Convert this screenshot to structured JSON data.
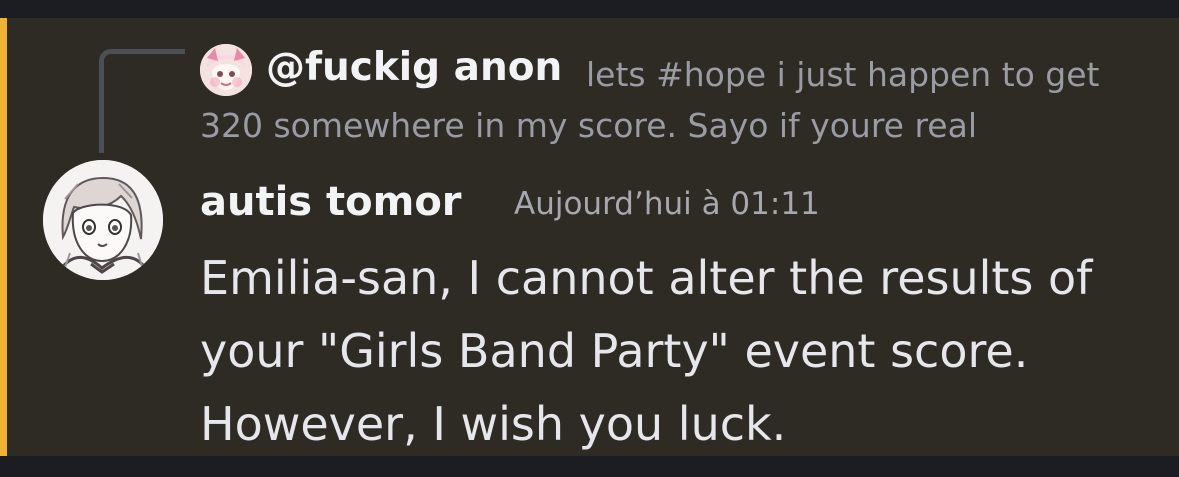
{
  "reply": {
    "author": "@fuckig anon",
    "preview": "lets #hope i just happen to get 320 somewhere in my score. Sayo if youre real",
    "avatar_icon": "anime-girl-avatar-icon"
  },
  "message": {
    "author": "autis tomor",
    "timestamp": "Aujourd’hui à 01:11",
    "avatar_icon": "sketched-anime-avatar-icon",
    "lines": [
      "Emilia-san, I cannot alter the results of",
      "your \"Girls Band Party\" event score.",
      "However, I wish you luck."
    ]
  },
  "colors": {
    "highlight_bar": "#f0b232",
    "message_background": "#2e2a24",
    "app_background": "#1c1d22"
  }
}
